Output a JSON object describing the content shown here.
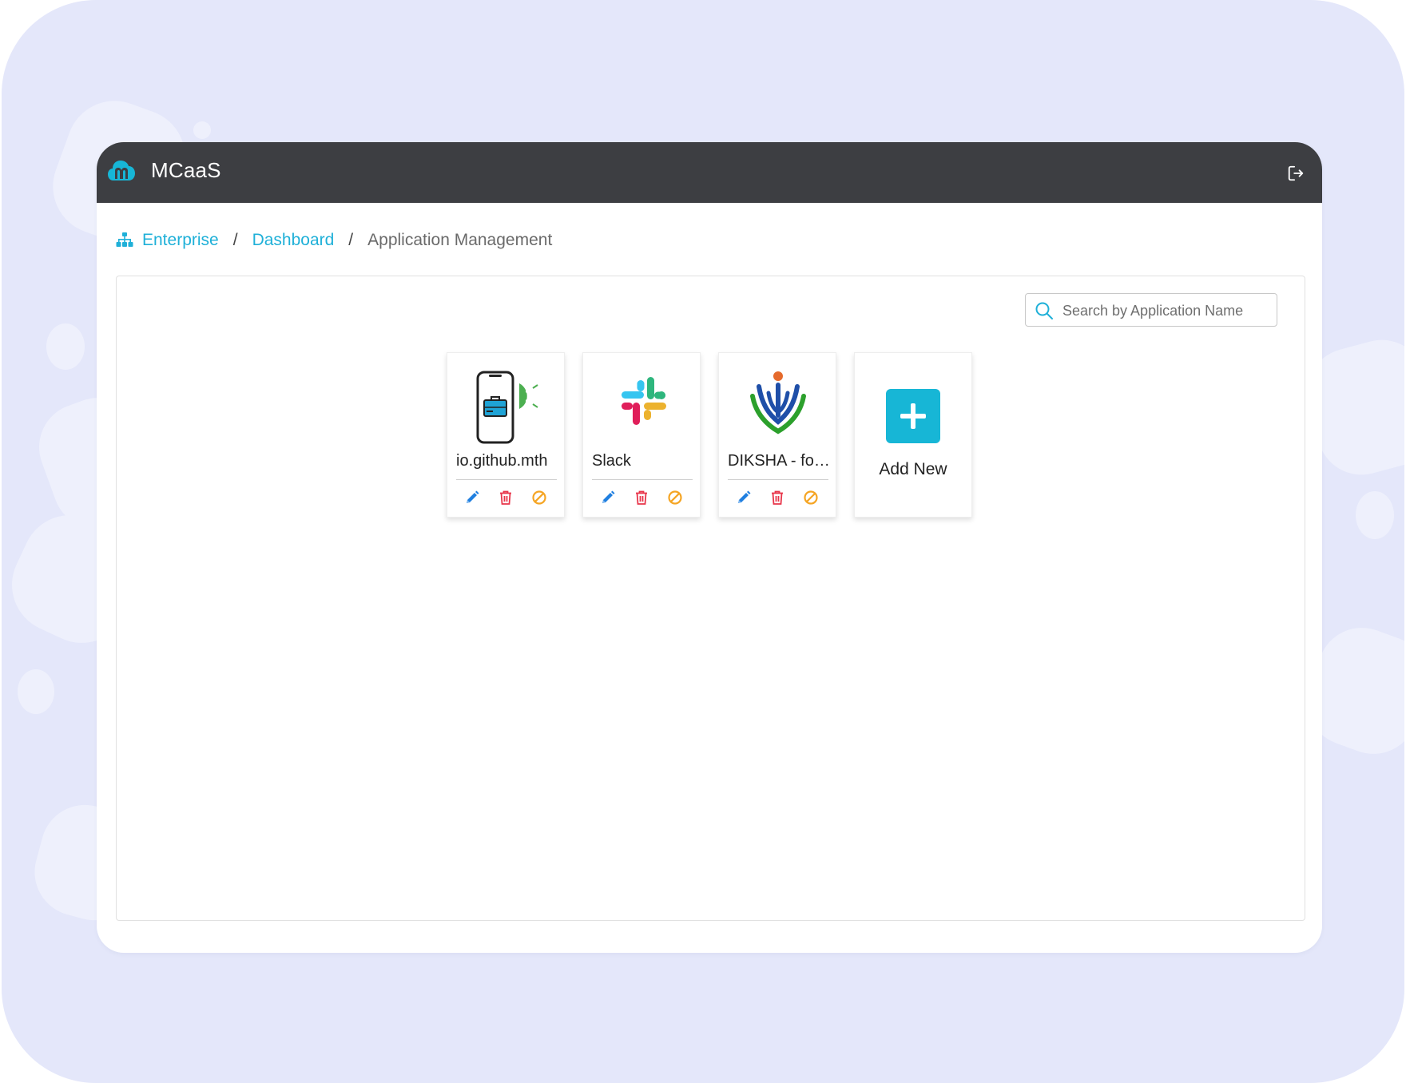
{
  "header": {
    "brand_name": "MCaaS",
    "logo_icon": "mcaas-cloud-logo-icon",
    "logout_icon": "logout-icon"
  },
  "breadcrumb": {
    "icon": "sitemap-icon",
    "items": [
      {
        "label": "Enterprise"
      },
      {
        "label": "Dashboard"
      }
    ],
    "separator": "/",
    "current": "Application Management"
  },
  "search": {
    "placeholder": "Search by Application Name",
    "value": ""
  },
  "apps": [
    {
      "name": "io.github.mth",
      "icon": "android-phone-briefcase-icon"
    },
    {
      "name": "Slack",
      "icon": "slack-logo-icon"
    },
    {
      "name": "DIKSHA - for teachers",
      "icon": "diksha-logo-icon"
    }
  ],
  "card_actions": {
    "edit_icon": "pencil-icon",
    "delete_icon": "trash-icon",
    "disable_icon": "ban-icon"
  },
  "add_new": {
    "label": "Add New",
    "icon": "plus-icon"
  },
  "colors": {
    "accent": "#17b6d6",
    "topbar": "#3d3e42",
    "edit": "#1f7fe0",
    "delete": "#e8354a",
    "disable": "#f5a524"
  }
}
